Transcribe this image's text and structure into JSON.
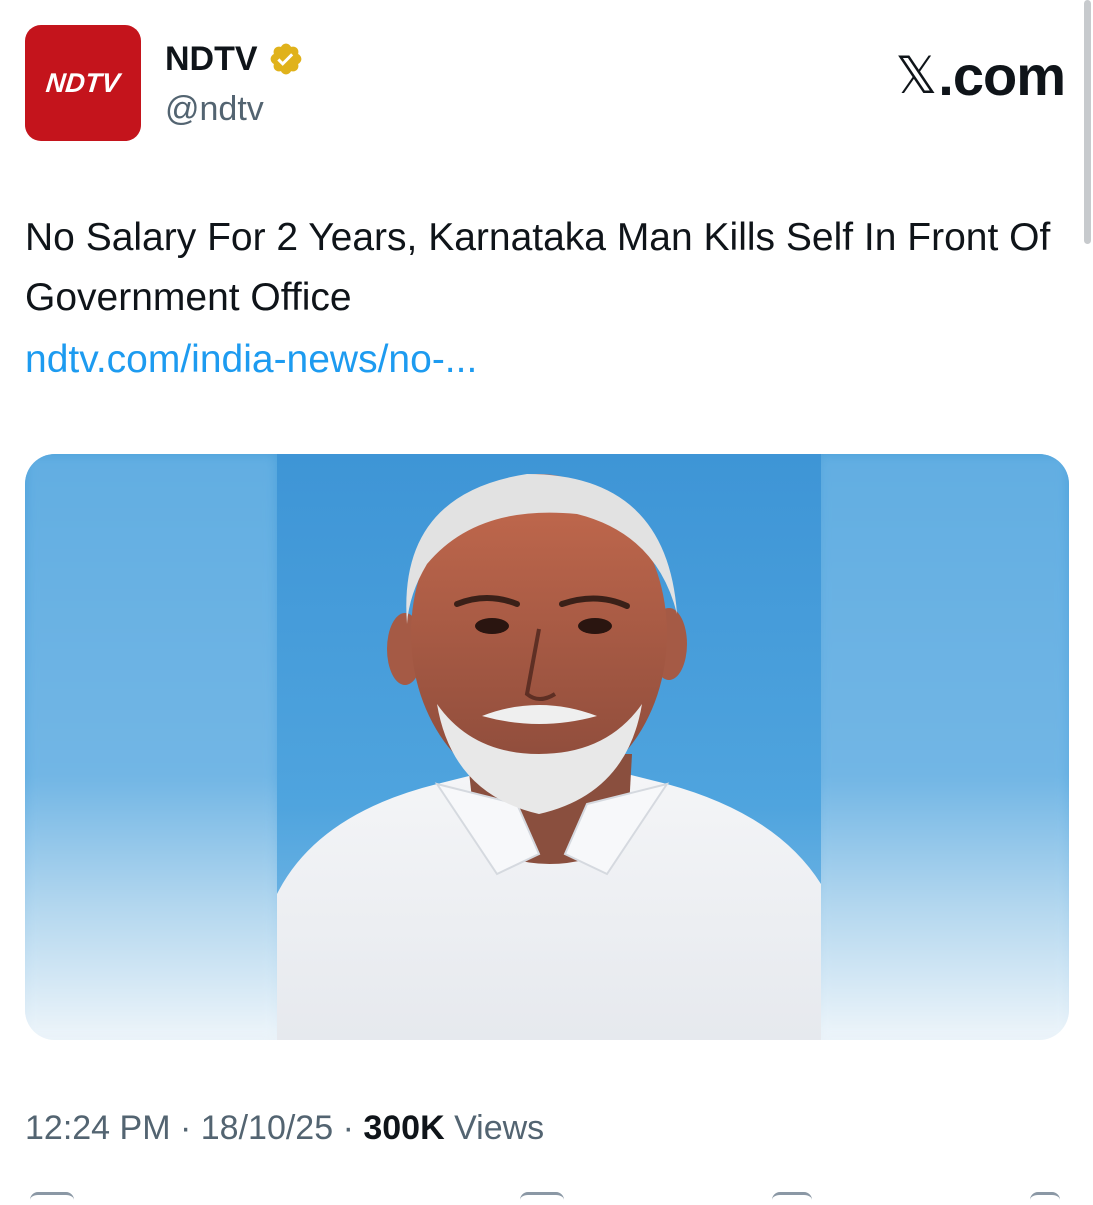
{
  "author": {
    "display_name": "NDTV",
    "handle": "@ndtv",
    "avatar_text": "NDTV",
    "verified": true,
    "verified_color": "#e0b21b"
  },
  "brand": {
    "x_glyph": "𝕏",
    "domain": ".com"
  },
  "tweet": {
    "text": "No Salary For 2 Years, Karnataka Man Kills Self In Front Of Government Office",
    "link": "ndtv.com/india-news/no-..."
  },
  "meta": {
    "time": "12:24 PM",
    "date": "18/10/25",
    "separator": "·",
    "views_count": "300K",
    "views_label": "Views"
  },
  "colors": {
    "accent": "#1d9bf0",
    "avatar_bg": "#c4141c",
    "secondary_text": "#536471",
    "primary_text": "#0f1419"
  },
  "icons": {
    "verified": "verified-badge-icon"
  }
}
